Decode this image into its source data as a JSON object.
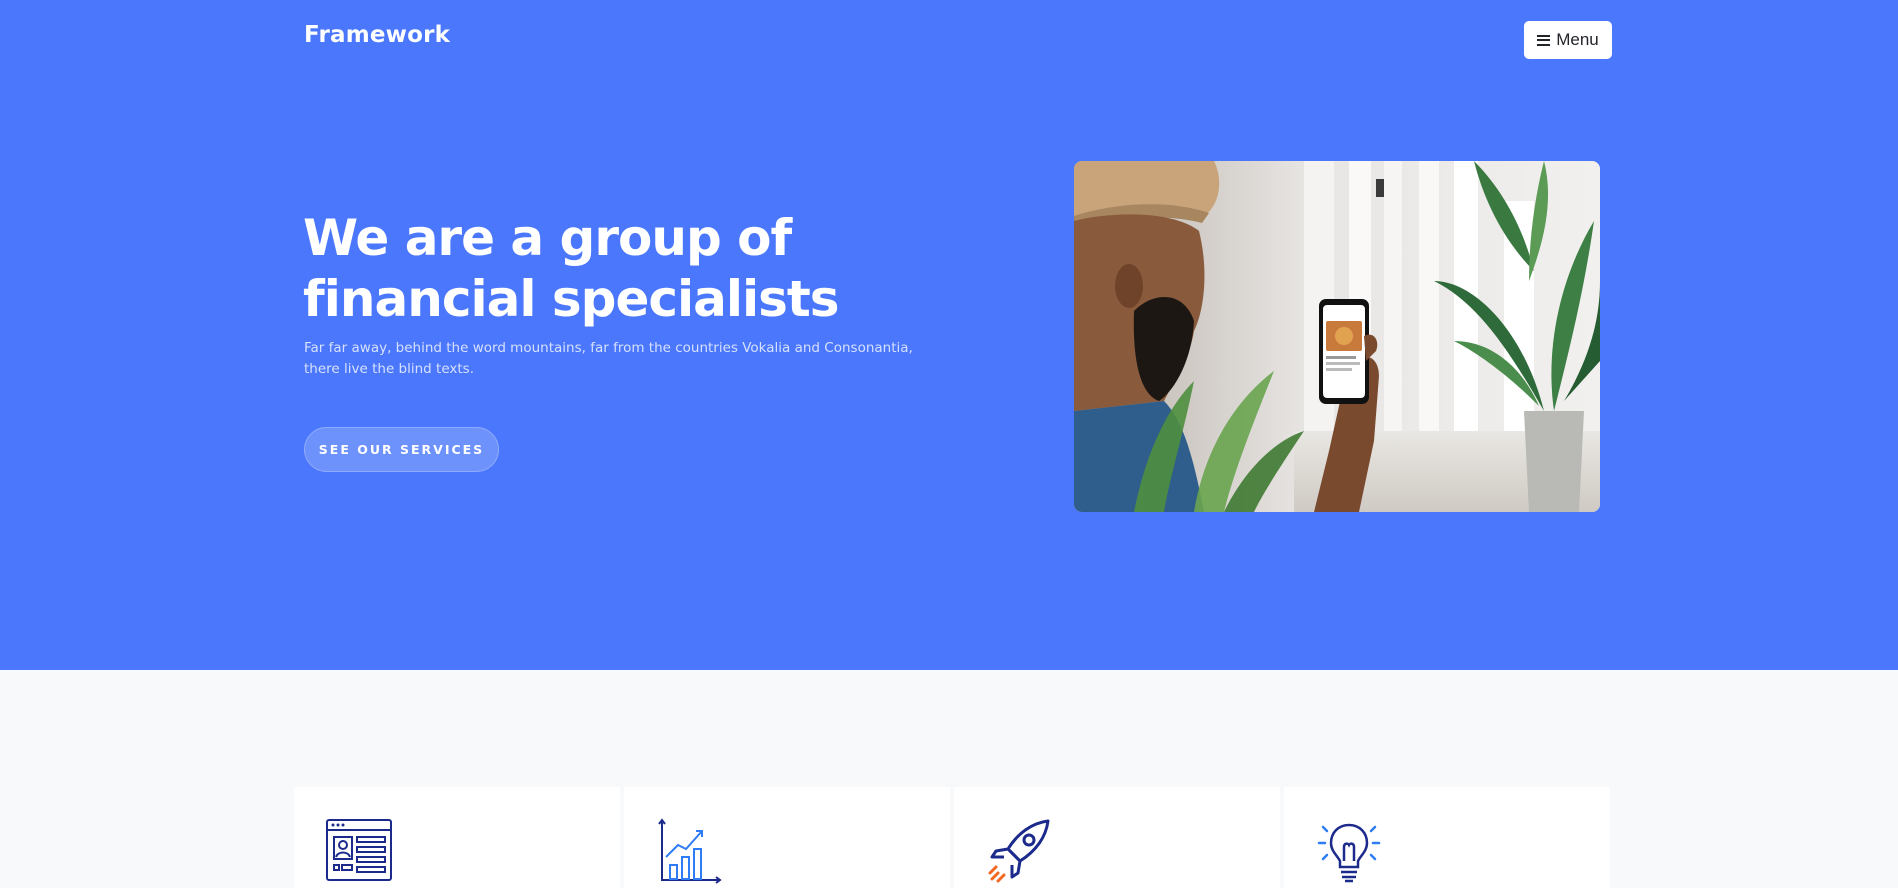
{
  "brand": {
    "name": "Framework"
  },
  "nav": {
    "menu_label": "Menu",
    "menu_icon": "hamburger-icon"
  },
  "hero": {
    "title_line1": "We are a group of",
    "title_line2": "financial specialists",
    "subtitle": "Far far away, behind the word mountains, far from the countries Vokalia and Consonantia, there live the blind texts.",
    "cta_label": "SEE OUR SERVICES",
    "image": "man-holding-smartphone-photo"
  },
  "features": {
    "icons": [
      "profile-layout-icon",
      "growth-chart-icon",
      "rocket-icon",
      "lightbulb-icon"
    ]
  },
  "colors": {
    "hero_bg": "#4a77fb",
    "accent_navy": "#1c2a8c",
    "accent_blue": "#2f7cf6",
    "accent_orange": "#f26722",
    "page_bg": "#f8f9fa"
  }
}
